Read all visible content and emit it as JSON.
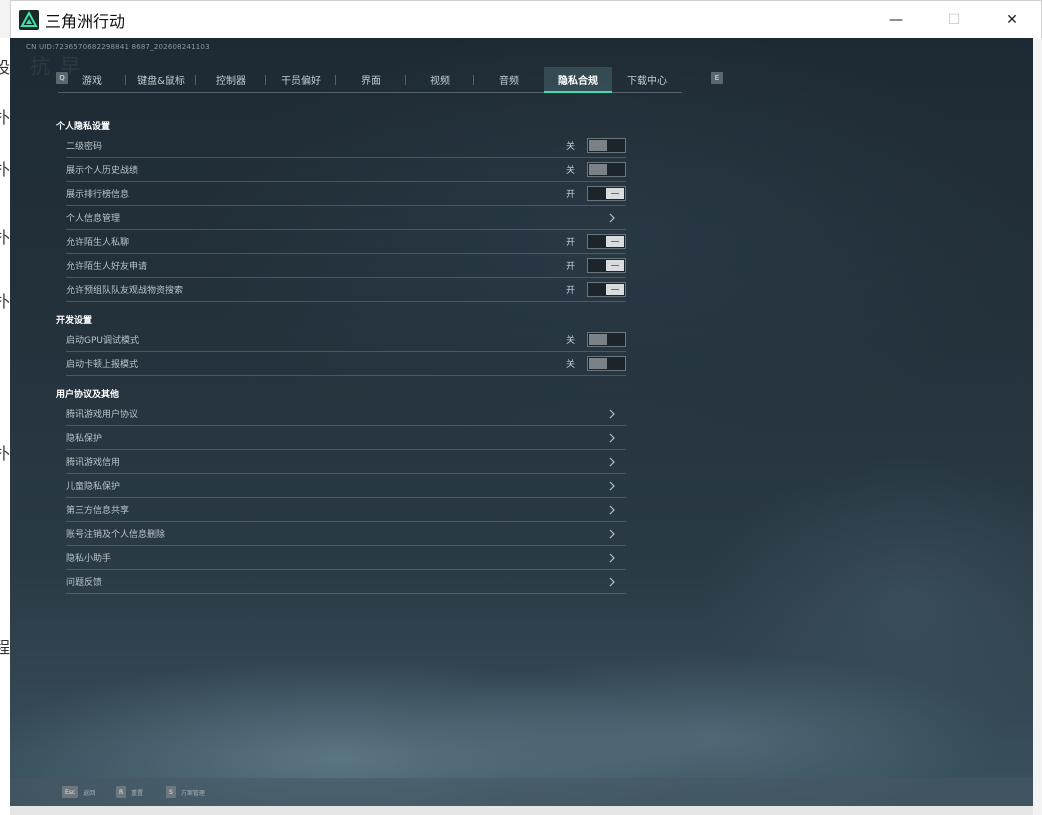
{
  "window": {
    "title": "三角洲行动",
    "minimize": "—",
    "maximize": "☐",
    "close": "✕"
  },
  "behind": [
    "设",
    "扑",
    "扑",
    "扑",
    "扑",
    "扑",
    "程"
  ],
  "game": {
    "uid": "CN UID:7236570682298841 8687_202608241103",
    "bg_text": "抗 早",
    "tab_key_left": "Q",
    "tab_key_right": "E",
    "tabs": [
      {
        "label": "游戏",
        "active": false
      },
      {
        "label": "键盘&鼠标",
        "active": false
      },
      {
        "label": "控制器",
        "active": false
      },
      {
        "label": "干员偏好",
        "active": false
      },
      {
        "label": "界面",
        "active": false
      },
      {
        "label": "视频",
        "active": false
      },
      {
        "label": "音频",
        "active": false
      },
      {
        "label": "隐私合规",
        "active": true
      },
      {
        "label": "下载中心",
        "active": false
      }
    ],
    "sections": [
      {
        "title": "个人隐私设置",
        "rows": [
          {
            "label": "二级密码",
            "type": "toggle",
            "state": "关",
            "on": false
          },
          {
            "label": "展示个人历史战绩",
            "type": "toggle",
            "state": "关",
            "on": false
          },
          {
            "label": "展示排行榜信息",
            "type": "toggle",
            "state": "开",
            "on": true
          },
          {
            "label": "个人信息管理",
            "type": "link"
          },
          {
            "label": "允许陌生人私聊",
            "type": "toggle",
            "state": "开",
            "on": true
          },
          {
            "label": "允许陌生人好友申请",
            "type": "toggle",
            "state": "开",
            "on": true
          },
          {
            "label": "允许预组队队友观战物资搜索",
            "type": "toggle",
            "state": "开",
            "on": true
          }
        ]
      },
      {
        "title": "开发设置",
        "rows": [
          {
            "label": "启动GPU调试模式",
            "type": "toggle",
            "state": "关",
            "on": false
          },
          {
            "label": "启动卡顿上报模式",
            "type": "toggle",
            "state": "关",
            "on": false
          }
        ]
      },
      {
        "title": "用户协议及其他",
        "rows": [
          {
            "label": "腾讯游戏用户协议",
            "type": "link"
          },
          {
            "label": "隐私保护",
            "type": "link"
          },
          {
            "label": "腾讯游戏信用",
            "type": "link"
          },
          {
            "label": "儿童隐私保护",
            "type": "link"
          },
          {
            "label": "第三方信息共享",
            "type": "link"
          },
          {
            "label": "账号注销及个人信息删除",
            "type": "link"
          },
          {
            "label": "隐私小助手",
            "type": "link"
          },
          {
            "label": "问题反馈",
            "type": "link"
          }
        ]
      }
    ],
    "footer": [
      {
        "key": "Esc",
        "label": "返回"
      },
      {
        "key": "R",
        "label": "重置"
      },
      {
        "key": "S",
        "label": "方案管理"
      }
    ]
  },
  "colors": {
    "active_tab_accent": "#3fe0b0",
    "background_top": "#1e2a33",
    "background_bottom": "#3b5260"
  }
}
